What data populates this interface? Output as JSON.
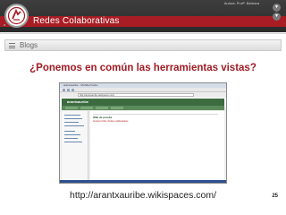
{
  "banner": {
    "title": "Redes Colaborativas",
    "credit": "Autora: Profª. Bárbara",
    "colors": {
      "dark": "#2f2f2f",
      "accent": "#a81c24"
    }
  },
  "section": {
    "label": "Blogs",
    "icon": "menu-lines-icon"
  },
  "slide": {
    "question": "¿Ponemos en común las herramientas vistas?",
    "url": "http://arantxauribe.wikispaces.com/",
    "page_number": "25",
    "accent_color": "#a01c24"
  },
  "screenshot": {
    "window_title": "arantxauribe - Mozilla Firefox",
    "address": "http://arantxauribe.wikispaces.com/",
    "site_name": "arantxauribe",
    "content_heading": "Wiki de prueba",
    "content_link": "Arantxa Uribe, Redes colaborativas"
  }
}
